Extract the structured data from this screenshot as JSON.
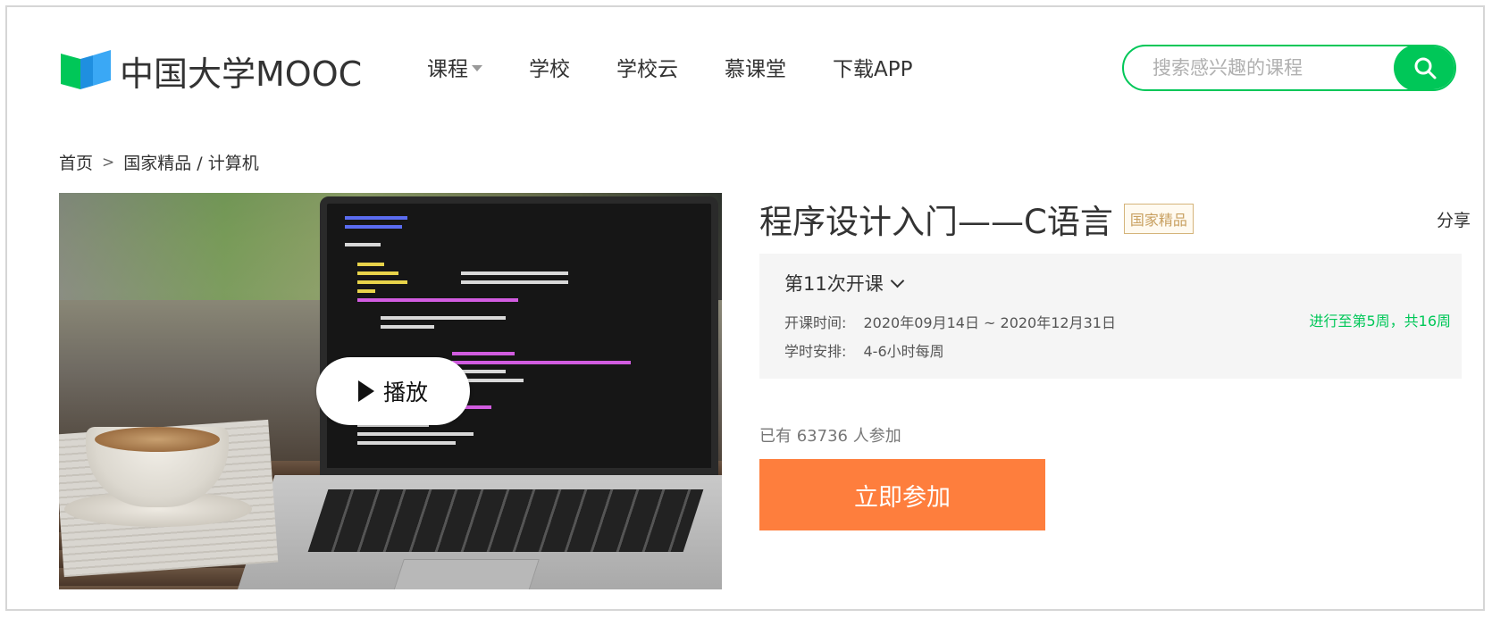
{
  "logo": {
    "text": "中国大学MOOC"
  },
  "nav": [
    {
      "label": "课程"
    },
    {
      "label": "学校"
    },
    {
      "label": "学校云"
    },
    {
      "label": "慕课堂"
    },
    {
      "label": "下载APP"
    }
  ],
  "search": {
    "placeholder": "搜索感兴趣的课程",
    "icon": "search-icon"
  },
  "breadcrumb": {
    "home": "首页",
    "separator": ">",
    "path": "国家精品 / 计算机"
  },
  "video": {
    "play_label": "播放"
  },
  "course": {
    "title": "程序设计入门——C语言",
    "badge": "国家精品",
    "share": "分享",
    "term": "第11次开课",
    "schedule_label": "开课时间:",
    "schedule_value": "2020年09月14日 ~ 2020年12月31日",
    "hours_label": "学时安排:",
    "hours_value": "4-6小时每周",
    "progress": "进行至第5周，共16周",
    "enrolled": "已有 63736 人参加",
    "join_label": "立即参加"
  },
  "colors": {
    "brand_green": "#00c758",
    "join_orange": "#fe7e3d",
    "badge_gold": "#c8a060"
  }
}
